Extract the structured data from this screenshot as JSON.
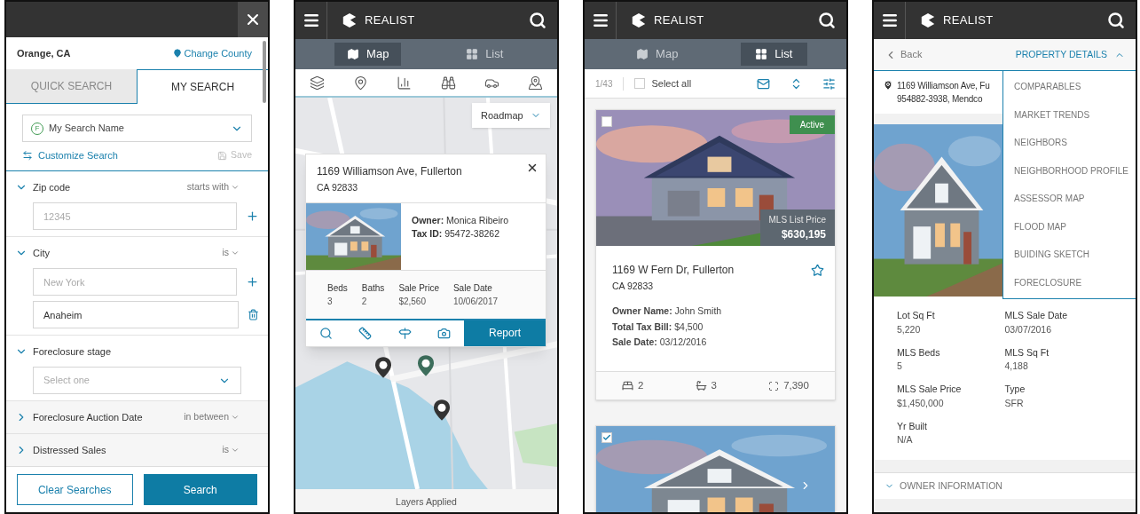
{
  "search_panel": {
    "county": "Orange, CA",
    "change_county": "Change County",
    "tabs": [
      {
        "label": "QUICK SEARCH",
        "selected": false
      },
      {
        "label": "MY SEARCH",
        "selected": true
      }
    ],
    "saved_search": {
      "badge": "F",
      "value": "My Search Name"
    },
    "customize": "Customize Search",
    "save": {
      "label": "Save",
      "disabled": true
    },
    "filters": [
      {
        "label": "Zip code",
        "operator": "starts with",
        "expanded": true,
        "kind": "inputs",
        "fields": [
          {
            "placeholder": "12345",
            "kind": "add"
          }
        ]
      },
      {
        "label": "City",
        "operator": "is",
        "expanded": true,
        "kind": "inputs",
        "fields": [
          {
            "placeholder": "New York",
            "kind": "add"
          },
          {
            "value": "Anaheim",
            "kind": "delete"
          }
        ]
      },
      {
        "label": "Foreclosure stage",
        "expanded": true,
        "kind": "select",
        "placeholder": "Select one"
      },
      {
        "label": "Foreclosure Auction Date",
        "operator": "in between",
        "expanded": false
      },
      {
        "label": "Distressed Sales",
        "operator": "is",
        "expanded": false
      }
    ],
    "buttons": [
      {
        "label": "Clear Searches",
        "kind": "secondary"
      },
      {
        "label": "Search",
        "kind": "primary"
      }
    ]
  },
  "map_screen": {
    "logo": "REALIST",
    "view_tabs": [
      {
        "label": "Map",
        "kind": "map",
        "selected": true
      },
      {
        "label": "List",
        "kind": "list",
        "selected": false
      }
    ],
    "map_style": "Roadmap",
    "popup": {
      "address": "1169 Williamson Ave, Fullerton",
      "zip": "CA 92833",
      "owner_label": "Owner:",
      "owner": "Monica Ribeiro",
      "tax_label": "Tax ID:",
      "tax_id": "95472-38262",
      "stats": [
        {
          "label": "Beds",
          "value": "3"
        },
        {
          "label": "Baths",
          "value": "2"
        },
        {
          "label": "Sale Price",
          "value": "$2,560"
        },
        {
          "label": "Sale Date",
          "value": "10/06/2017"
        }
      ],
      "report": "Report"
    },
    "layers": "Layers Applied"
  },
  "list_screen": {
    "logo": "REALIST",
    "view_tabs": [
      {
        "label": "Map",
        "kind": "map",
        "selected": false
      },
      {
        "label": "List",
        "kind": "list",
        "selected": true
      }
    ],
    "count": "1/43",
    "select_all": {
      "label": "Select all",
      "checked": false
    },
    "listings": [
      {
        "checked": false,
        "status": "Active",
        "price_label": "MLS List Price",
        "price": "$630,195",
        "address": "1169 W Fern Dr, Fullerton",
        "zip": "CA 92833",
        "details": [
          {
            "label": "Owner Name:",
            "value": "John Smith"
          },
          {
            "label": "Total Tax Bill:",
            "value": "$4,500"
          },
          {
            "label": "Sale Date:",
            "value": "03/12/2016"
          }
        ],
        "beds": "2",
        "baths": "3",
        "area": "7,390"
      },
      {
        "checked": true
      }
    ]
  },
  "details_screen": {
    "logo": "REALIST",
    "back": "Back",
    "section_menu": {
      "label": "PROPERTY DETAILS",
      "expanded": true,
      "items": [
        "COMPARABLES",
        "MARKET TRENDS",
        "NEIGHBORS",
        "NEIGHBORHOOD PROFILE",
        "ASSESSOR MAP",
        "FLOOD MAP",
        "BUIDING SKETCH",
        "FORECLOSURE"
      ]
    },
    "address_lines": [
      "1169 Williamson Ave, Fu",
      "954882-3938, Mendco"
    ],
    "facts": [
      {
        "label": "Lot Sq Ft",
        "value": "5,220"
      },
      {
        "label": "MLS Sale Date",
        "value": "03/07/2016"
      },
      {
        "label": "MLS Beds",
        "value": "5"
      },
      {
        "label": "MLS Sq Ft",
        "value": "4,188"
      },
      {
        "label": "MLS Sale Price",
        "value": "$1,450,000"
      },
      {
        "label": "Type",
        "value": "SFR"
      },
      {
        "label": "Yr Built",
        "value": "N/A"
      }
    ],
    "owner_section": {
      "label": "OWNER INFORMATION",
      "expanded": false
    }
  }
}
